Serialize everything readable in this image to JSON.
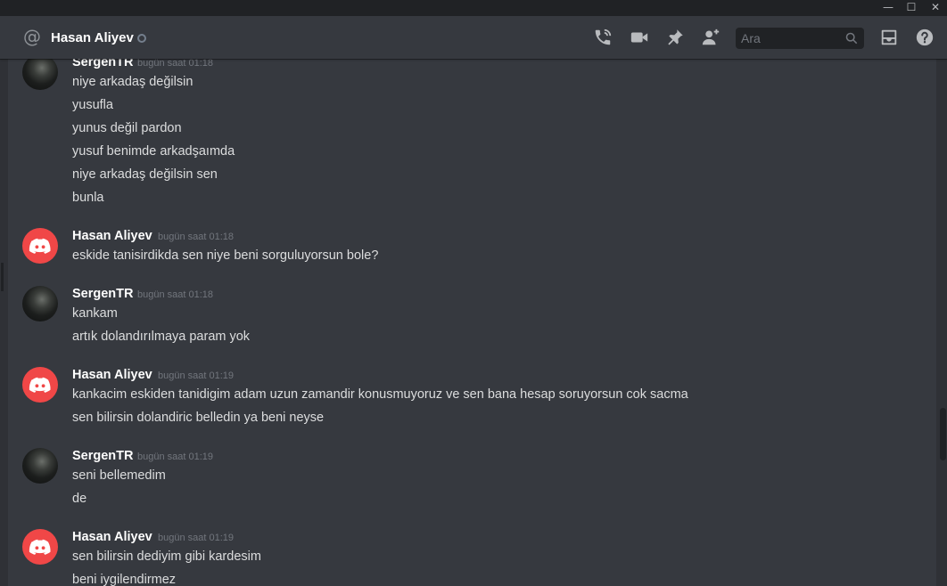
{
  "window": {
    "minimize": "—",
    "maximize": "☐",
    "close": "✕"
  },
  "header": {
    "channel_name": "Hasan Aliyev",
    "search_placeholder": "Ara"
  },
  "icons": [
    "at-icon",
    "call-icon",
    "video-icon",
    "pin-icon",
    "add-friend-icon",
    "search-icon",
    "inbox-icon",
    "help-icon"
  ],
  "colors": {
    "background": "#36393f",
    "titlebar": "#202225",
    "discord_red": "#f04747",
    "timestamp": "#72767d",
    "text": "#dcddde"
  },
  "messages": [
    {
      "author": "SergenTR",
      "timestamp": "bugün saat 01:18",
      "avatar": "photo",
      "lines": [
        "niye arkadaş değilsin",
        "yusufla",
        "yunus değil pardon",
        "yusuf benimde arkadşaımda",
        "niye arkadaş değilsin sen",
        "bunla"
      ]
    },
    {
      "author": "Hasan Aliyev",
      "timestamp": "bugün saat 01:18",
      "avatar": "discord",
      "lines": [
        "eskide tanisirdikda sen niye beni sorguluyorsun bole?"
      ]
    },
    {
      "author": "SergenTR",
      "timestamp": "bugün saat 01:18",
      "avatar": "photo",
      "lines": [
        "kankam",
        "artık dolandırılmaya param yok"
      ]
    },
    {
      "author": "Hasan Aliyev",
      "timestamp": "bugün saat 01:19",
      "avatar": "discord",
      "lines": [
        "kankacim eskiden tanidigim adam uzun zamandir konusmuyoruz ve sen bana hesap soruyorsun cok sacma",
        "sen bilirsin dolandiric belledin ya beni neyse"
      ]
    },
    {
      "author": "SergenTR",
      "timestamp": "bugün saat 01:19",
      "avatar": "photo",
      "lines": [
        "seni bellemedim",
        "de"
      ]
    },
    {
      "author": "Hasan Aliyev",
      "timestamp": "bugün saat 01:19",
      "avatar": "discord",
      "lines": [
        "sen bilirsin dediyim gibi kardesim",
        "beni iygilendirmez"
      ]
    }
  ]
}
